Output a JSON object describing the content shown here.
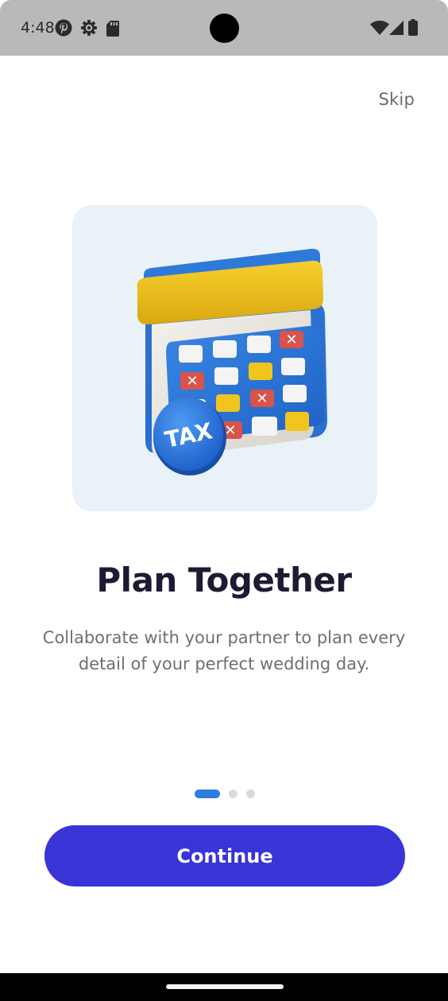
{
  "status_bar": {
    "time": "4:48",
    "icons_left": [
      "pinterest-icon",
      "settings-gear-icon",
      "sd-card-icon"
    ],
    "icons_right": [
      "wifi-icon",
      "cellular-signal-icon",
      "battery-icon"
    ]
  },
  "header": {
    "skip_label": "Skip"
  },
  "illustration": {
    "icon": "calendar-tax-illustration",
    "badge_text": "TAX"
  },
  "content": {
    "title": "Plan Together",
    "subtitle": "Collaborate with your partner to plan every detail of your perfect wedding day."
  },
  "pagination": {
    "current": 1,
    "total": 3
  },
  "actions": {
    "continue_label": "Continue"
  },
  "colors": {
    "primary_button": "#3834d8",
    "active_dot": "#2e7de0",
    "title_text": "#1c1b33",
    "card_background": "#e9f2f9"
  }
}
